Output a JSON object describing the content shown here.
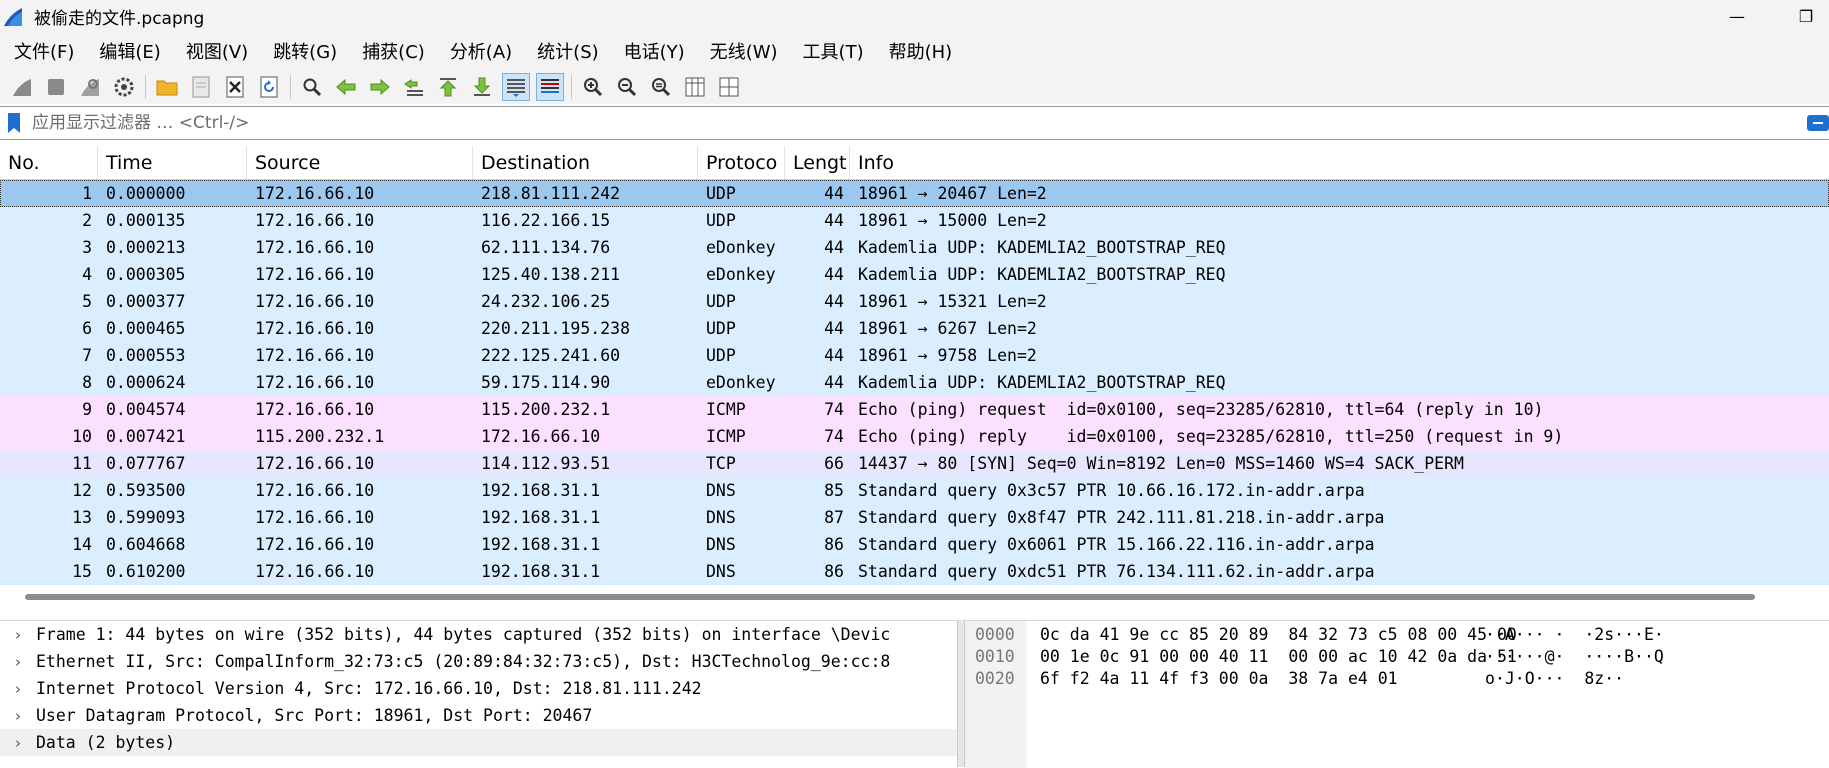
{
  "window": {
    "title": "被偷走的文件.pcapng",
    "minimize_label": "—",
    "maximize_label": "❐"
  },
  "menu": [
    "文件(F)",
    "编辑(E)",
    "视图(V)",
    "跳转(G)",
    "捕获(C)",
    "分析(A)",
    "统计(S)",
    "电话(Y)",
    "无线(W)",
    "工具(T)",
    "帮助(H)"
  ],
  "toolbar": {
    "icons": [
      "shark-fin-start-icon",
      "stop-icon",
      "restart-icon",
      "capture-options-icon",
      "|",
      "open-folder-icon",
      "save-file-icon",
      "close-file-icon",
      "reload-icon",
      "|",
      "find-icon",
      "go-back-icon",
      "go-forward-icon",
      "go-to-packet-icon",
      "first-packet-icon",
      "last-packet-icon",
      "autoscroll-icon",
      "colorize-icon",
      "|",
      "zoom-in-icon",
      "zoom-out-icon",
      "zoom-reset-icon",
      "resize-columns-icon",
      "layout-icon"
    ]
  },
  "filter": {
    "placeholder": "应用显示过滤器 … <Ctrl-/>"
  },
  "packet_list": {
    "columns": [
      "No.",
      "Time",
      "Source",
      "Destination",
      "Protoco",
      "Lengt",
      "Info"
    ],
    "rows": [
      {
        "no": "1",
        "time": "0.000000",
        "src": "172.16.66.10",
        "dst": "218.81.111.242",
        "proto": "UDP",
        "len": "44",
        "info": "18961 → 20467 Len=2",
        "color": "#daeeff",
        "selected": true
      },
      {
        "no": "2",
        "time": "0.000135",
        "src": "172.16.66.10",
        "dst": "116.22.166.15",
        "proto": "UDP",
        "len": "44",
        "info": "18961 → 15000 Len=2",
        "color": "#daeeff"
      },
      {
        "no": "3",
        "time": "0.000213",
        "src": "172.16.66.10",
        "dst": "62.111.134.76",
        "proto": "eDonkey",
        "len": "44",
        "info": "Kademlia UDP: KADEMLIA2_BOOTSTRAP_REQ",
        "color": "#daeeff"
      },
      {
        "no": "4",
        "time": "0.000305",
        "src": "172.16.66.10",
        "dst": "125.40.138.211",
        "proto": "eDonkey",
        "len": "44",
        "info": "Kademlia UDP: KADEMLIA2_BOOTSTRAP_REQ",
        "color": "#daeeff"
      },
      {
        "no": "5",
        "time": "0.000377",
        "src": "172.16.66.10",
        "dst": "24.232.106.25",
        "proto": "UDP",
        "len": "44",
        "info": "18961 → 15321 Len=2",
        "color": "#daeeff"
      },
      {
        "no": "6",
        "time": "0.000465",
        "src": "172.16.66.10",
        "dst": "220.211.195.238",
        "proto": "UDP",
        "len": "44",
        "info": "18961 → 6267 Len=2",
        "color": "#daeeff"
      },
      {
        "no": "7",
        "time": "0.000553",
        "src": "172.16.66.10",
        "dst": "222.125.241.60",
        "proto": "UDP",
        "len": "44",
        "info": "18961 → 9758 Len=2",
        "color": "#daeeff"
      },
      {
        "no": "8",
        "time": "0.000624",
        "src": "172.16.66.10",
        "dst": "59.175.114.90",
        "proto": "eDonkey",
        "len": "44",
        "info": "Kademlia UDP: KADEMLIA2_BOOTSTRAP_REQ",
        "color": "#daeeff"
      },
      {
        "no": "9",
        "time": "0.004574",
        "src": "172.16.66.10",
        "dst": "115.200.232.1",
        "proto": "ICMP",
        "len": "74",
        "info": "Echo (ping) request  id=0x0100, seq=23285/62810, ttl=64 (reply in 10)",
        "color": "#fce0ff"
      },
      {
        "no": "10",
        "time": "0.007421",
        "src": "115.200.232.1",
        "dst": "172.16.66.10",
        "proto": "ICMP",
        "len": "74",
        "info": "Echo (ping) reply    id=0x0100, seq=23285/62810, ttl=250 (request in 9)",
        "color": "#fce0ff"
      },
      {
        "no": "11",
        "time": "0.077767",
        "src": "172.16.66.10",
        "dst": "114.112.93.51",
        "proto": "TCP",
        "len": "66",
        "info": "14437 → 80 [SYN] Seq=0 Win=8192 Len=0 MSS=1460 WS=4 SACK_PERM",
        "color": "#e7e6ff"
      },
      {
        "no": "12",
        "time": "0.593500",
        "src": "172.16.66.10",
        "dst": "192.168.31.1",
        "proto": "DNS",
        "len": "85",
        "info": "Standard query 0x3c57 PTR 10.66.16.172.in-addr.arpa",
        "color": "#daeeff"
      },
      {
        "no": "13",
        "time": "0.599093",
        "src": "172.16.66.10",
        "dst": "192.168.31.1",
        "proto": "DNS",
        "len": "87",
        "info": "Standard query 0x8f47 PTR 242.111.81.218.in-addr.arpa",
        "color": "#daeeff"
      },
      {
        "no": "14",
        "time": "0.604668",
        "src": "172.16.66.10",
        "dst": "192.168.31.1",
        "proto": "DNS",
        "len": "86",
        "info": "Standard query 0x6061 PTR 15.166.22.116.in-addr.arpa",
        "color": "#daeeff"
      },
      {
        "no": "15",
        "time": "0.610200",
        "src": "172.16.66.10",
        "dst": "192.168.31.1",
        "proto": "DNS",
        "len": "86",
        "info": "Standard query 0xdc51 PTR 76.134.111.62.in-addr.arpa",
        "color": "#daeeff"
      }
    ]
  },
  "details": [
    "Frame 1: 44 bytes on wire (352 bits), 44 bytes captured (352 bits) on interface \\Devic",
    "Ethernet II, Src: CompalInform_32:73:c5 (20:89:84:32:73:c5), Dst: H3CTechnolog_9e:cc:8",
    "Internet Protocol Version 4, Src: 172.16.66.10, Dst: 218.81.111.242",
    "User Datagram Protocol, Src Port: 18961, Dst Port: 20467",
    "Data (2 bytes)"
  ],
  "bytes": [
    {
      "offset": "0000",
      "hex": "0c da 41 9e cc 85 20 89  84 32 73 c5 08 00 45 00",
      "ascii": "··A··· ·  ·2s···E·"
    },
    {
      "offset": "0010",
      "hex": "00 1e 0c 91 00 00 40 11  00 00 ac 10 42 0a da 51",
      "ascii": "······@·  ····B··Q"
    },
    {
      "offset": "0020",
      "hex": "6f f2 4a 11 4f f3 00 0a  38 7a e4 01",
      "ascii": "o·J·O···  8z··"
    }
  ],
  "colors": {
    "udp_row": "#daeeff",
    "icmp_row": "#fce0ff",
    "tcp_syn_row": "#e7e6ff",
    "selected_row": "#9cc7ef"
  }
}
